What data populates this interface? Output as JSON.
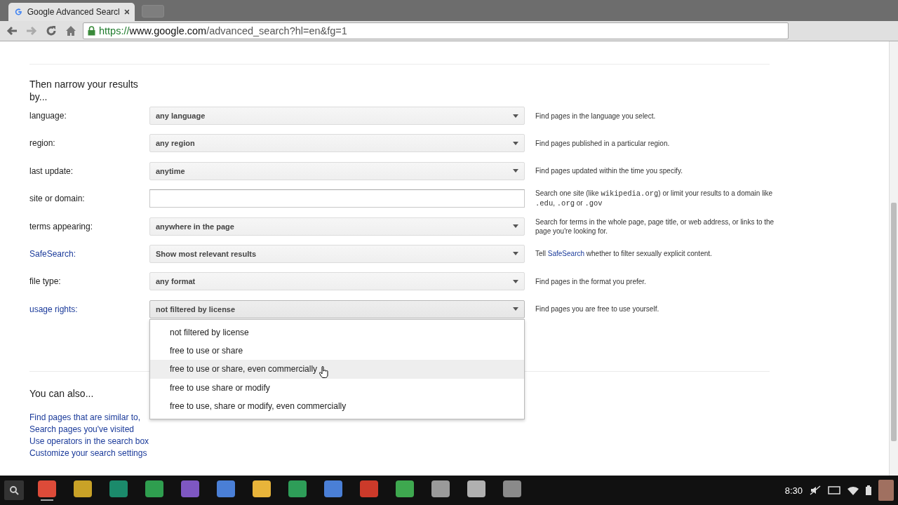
{
  "browser": {
    "tab_title": "Google Advanced Searcl",
    "url": {
      "scheme": "https://",
      "host": "www.google.com",
      "path": "/advanced_search?hl=en&fg=1"
    }
  },
  "section_title": "Then narrow your results by...",
  "rows": [
    {
      "label": "language:",
      "label_link": false,
      "kind": "select",
      "value": "any language",
      "open": false,
      "hint": [
        {
          "kind": "text",
          "text": "Find pages in the language you select."
        }
      ]
    },
    {
      "label": "region:",
      "label_link": false,
      "kind": "select",
      "value": "any region",
      "open": false,
      "hint": [
        {
          "kind": "text",
          "text": "Find pages published in a particular region."
        }
      ]
    },
    {
      "label": "last update:",
      "label_link": false,
      "kind": "select",
      "value": "anytime",
      "open": false,
      "hint": [
        {
          "kind": "text",
          "text": "Find pages updated within the time you specify."
        }
      ]
    },
    {
      "label": "site or domain:",
      "label_link": false,
      "kind": "text",
      "hint": [
        {
          "kind": "text",
          "text": "Search one site (like "
        },
        {
          "kind": "code",
          "text": "wikipedia.org"
        },
        {
          "kind": "text",
          "text": ") or limit your results to a domain like "
        },
        {
          "kind": "code",
          "text": ".edu"
        },
        {
          "kind": "text",
          "text": ", "
        },
        {
          "kind": "code",
          "text": ".org"
        },
        {
          "kind": "text",
          "text": " or "
        },
        {
          "kind": "code",
          "text": ".gov"
        }
      ]
    },
    {
      "label": "terms appearing:",
      "label_link": false,
      "kind": "select",
      "value": "anywhere in the page",
      "open": false,
      "hint": [
        {
          "kind": "text",
          "text": "Search for terms in the whole page, page title, or web address, or links to the page you're looking for."
        }
      ]
    },
    {
      "label": "SafeSearch:",
      "label_link": true,
      "kind": "select",
      "value": "Show most relevant results",
      "open": false,
      "hint": [
        {
          "kind": "text",
          "text": "Tell "
        },
        {
          "kind": "link",
          "text": "SafeSearch"
        },
        {
          "kind": "text",
          "text": " whether to filter sexually explicit content."
        }
      ]
    },
    {
      "label": "file type:",
      "label_link": false,
      "kind": "select",
      "value": "any format",
      "open": false,
      "hint": [
        {
          "kind": "text",
          "text": "Find pages in the format you prefer."
        }
      ]
    },
    {
      "label": "usage rights:",
      "label_link": true,
      "kind": "select",
      "value": "not filtered by license",
      "open": true,
      "hint": [
        {
          "kind": "text",
          "text": "Find pages you are free to use yourself."
        }
      ],
      "options": [
        {
          "text": "not filtered by license",
          "highlighted": false
        },
        {
          "text": "free to use or share",
          "highlighted": false
        },
        {
          "text": "free to use or share, even commercially",
          "highlighted": true
        },
        {
          "text": "free to use share or modify",
          "highlighted": false
        },
        {
          "text": "free to use, share or modify, even commercially",
          "highlighted": false
        }
      ]
    }
  ],
  "also_title": "You can also...",
  "also_links": [
    "Find pages that are similar to,",
    "Search pages you've visited",
    "Use operators in the search box",
    "Customize your search settings"
  ],
  "shelf": {
    "apps": [
      {
        "color": "#dd4b39",
        "active": true
      },
      {
        "color": "#c9a227",
        "active": false
      },
      {
        "color": "#1b8a6b",
        "active": false
      },
      {
        "color": "#2f9e4f",
        "active": false
      },
      {
        "color": "#7e57c2",
        "active": false
      },
      {
        "color": "#4a7fd6",
        "active": false
      },
      {
        "color": "#e8b43a",
        "active": false
      },
      {
        "color": "#2e9d58",
        "active": false
      },
      {
        "color": "#4a7fd6",
        "active": false
      },
      {
        "color": "#cc3a2a",
        "active": false
      },
      {
        "color": "#3ea84f",
        "active": false
      },
      {
        "color": "#9a9a9a",
        "active": false
      },
      {
        "color": "#b0b0b0",
        "active": false
      },
      {
        "color": "#8a8a8a",
        "active": false
      }
    ],
    "time": "8:30"
  }
}
